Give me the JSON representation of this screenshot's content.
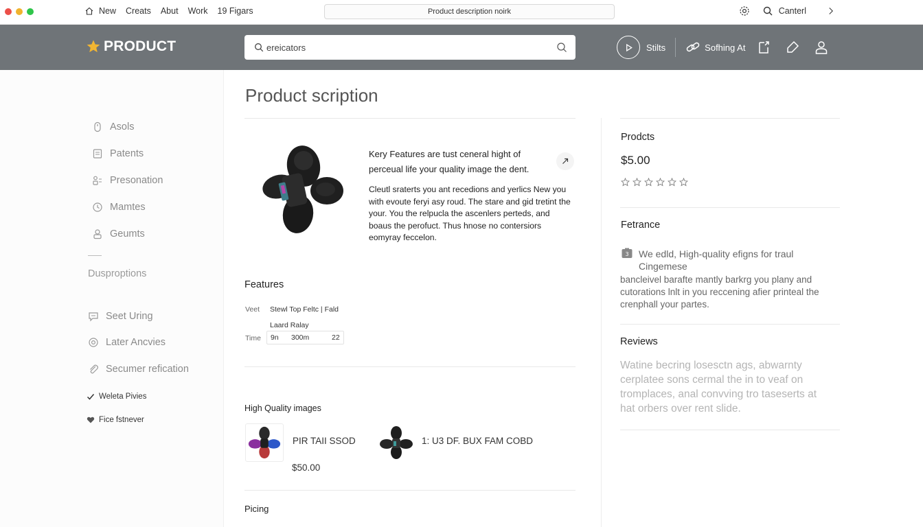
{
  "browser": {
    "dots": [
      "#ec4f48",
      "#f0b32e",
      "#2fc54a"
    ],
    "nav": [
      "New",
      "Creats",
      "Abut",
      "Work",
      "19 Figars"
    ],
    "url": "Product description noirk",
    "right_label": "Canterl"
  },
  "header": {
    "brand": "PRODUCT",
    "brand_star_color": "#f2b632",
    "search_value": "ereicators",
    "btn_play_label": "Stilts",
    "btn_setting_label": "Sofhing At",
    "bg_color": "#6f7478"
  },
  "sidebar": {
    "items": [
      "Asols",
      "Patents",
      "Presonation",
      "Mamtes",
      "Geumts"
    ],
    "section": "Dusproptions",
    "items2": [
      "Seet Uring",
      "Later Ancvies",
      "Secumer refication"
    ],
    "small": [
      "Weleta Pivies",
      "Fice fstnever"
    ]
  },
  "main": {
    "title": "Product scription",
    "key_features": "Kery Features are tust ceneral hight of perceual life your quality image the dent.",
    "description": "Cleutl sraterts you ant recedions and yerlics New you with evoute feryi asy roud. The stare and gid tretint the your. You the relpucla the ascenlers perteds, and boaus the perofuct. Thus hnose no contersiors eomyray feccelon.",
    "features_label": "Features",
    "spec": {
      "row1_label": "Veet",
      "row1_value": "Stewl Top Feltc | Fald",
      "sub": "Laard Ralay",
      "row2_label": "Time",
      "row2_values": [
        "9n",
        "300m",
        "22"
      ]
    },
    "images_label": "High Quality images",
    "thumbs": [
      {
        "name": "PIR TAII SSOD",
        "price": "$50.00"
      },
      {
        "name": "1: U3 DF. BUX FAM COBD"
      }
    ],
    "pricing_label": "Picing"
  },
  "right": {
    "products_label": "Prodcts",
    "price": "$5.00",
    "rating_stars": 6,
    "fetrance_label": "Fetrance",
    "fetrance_title": "We edld, High-quality efigns for traul Cingemese",
    "fetrance_text": "bancleivel barafte mantly barkrg you plany and cutorations lnlt in you reccening afier printeal the crenphall your partes.",
    "reviews_label": "Reviews",
    "reviews_text": "Watine becring losesctn ags, abwarnty cerplatee sons cermal the in to veaf on tromplaces, anal convving tro taseserts at hat orbers over rent slide."
  }
}
